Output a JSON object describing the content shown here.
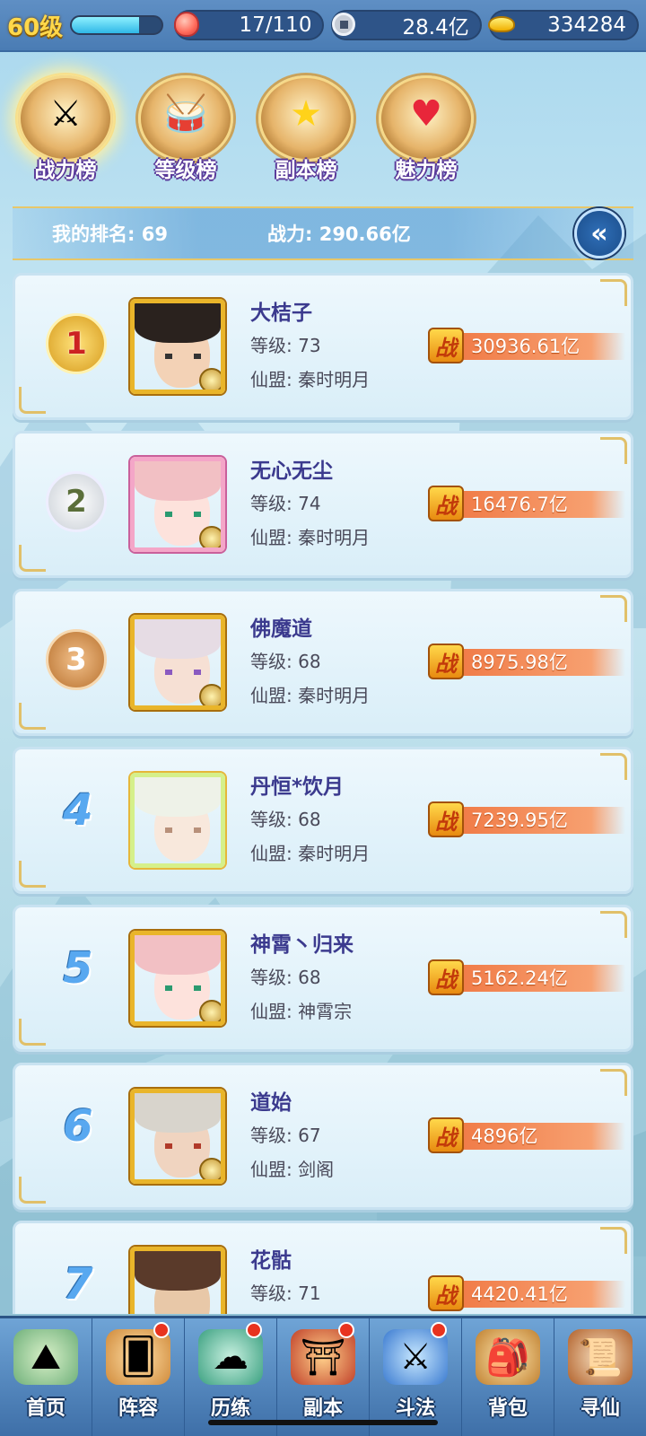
{
  "header": {
    "level": "60级",
    "exp_progress": 0.75,
    "stamina": "17/110",
    "silver": "28.4亿",
    "gold": "334284"
  },
  "tabs": [
    {
      "label": "战力榜",
      "icon": "sword-shield-icon",
      "active": true
    },
    {
      "label": "等级榜",
      "icon": "drum-icon",
      "active": false
    },
    {
      "label": "副本榜",
      "icon": "stars-icon",
      "active": false
    },
    {
      "label": "魅力榜",
      "icon": "heart-icon",
      "active": false
    }
  ],
  "my": {
    "rank": "我的排名: 69",
    "power": "战力: 290.66亿"
  },
  "power_badge": "战",
  "rows": [
    {
      "rank": "1",
      "name": "大桔子",
      "level": "等级: 73",
      "guild": "仙盟: 秦时明月",
      "power": "30936.61亿"
    },
    {
      "rank": "2",
      "name": "无心无尘",
      "level": "等级: 74",
      "guild": "仙盟: 秦时明月",
      "power": "16476.7亿"
    },
    {
      "rank": "3",
      "name": "佛魔道",
      "level": "等级: 68",
      "guild": "仙盟: 秦时明月",
      "power": "8975.98亿"
    },
    {
      "rank": "4",
      "name": "丹恒*饮月",
      "level": "等级: 68",
      "guild": "仙盟: 秦时明月",
      "power": "7239.95亿"
    },
    {
      "rank": "5",
      "name": "神霄丶归来",
      "level": "等级: 68",
      "guild": "仙盟: 神霄宗",
      "power": "5162.24亿"
    },
    {
      "rank": "6",
      "name": "道始",
      "level": "等级: 67",
      "guild": "仙盟: 剑阁",
      "power": "4896亿"
    },
    {
      "rank": "7",
      "name": "花骷",
      "level": "等级: 71",
      "guild": "",
      "power": "4420.41亿"
    }
  ],
  "nav": [
    {
      "label": "首页",
      "icon": "island-icon",
      "dot": false
    },
    {
      "label": "阵容",
      "icon": "cards-icon",
      "dot": true
    },
    {
      "label": "历练",
      "icon": "gourd-icon",
      "dot": true
    },
    {
      "label": "副本",
      "icon": "temple-gate-icon",
      "dot": true
    },
    {
      "label": "斗法",
      "icon": "crossed-swords-icon",
      "dot": true
    },
    {
      "label": "背包",
      "icon": "bag-icon",
      "dot": false
    },
    {
      "label": "寻仙",
      "icon": "scroll-icon",
      "dot": false
    }
  ],
  "colors": {
    "accent_gold": "#e9b52a",
    "power_bar": "#f07a46",
    "name_text": "#3b3a8e",
    "rank_number": "#58a8f0"
  }
}
